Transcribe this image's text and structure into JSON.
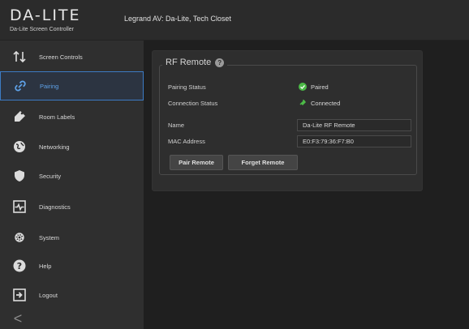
{
  "header": {
    "logo": "DA-LITE",
    "logo_sub": "Da-Lite Screen Controller",
    "device_title": "Legrand AV: Da-Lite, Tech Closet"
  },
  "sidebar": {
    "items": [
      {
        "label": "Screen Controls",
        "icon": "up-down-arrows-icon"
      },
      {
        "label": "Pairing",
        "icon": "link-icon",
        "active": true
      },
      {
        "label": "Room Labels",
        "icon": "tag-icon"
      },
      {
        "label": "Networking",
        "icon": "globe-icon"
      },
      {
        "label": "Security",
        "icon": "shield-icon"
      },
      {
        "label": "Diagnostics",
        "icon": "pulse-icon"
      },
      {
        "label": "System",
        "icon": "gear-icon"
      },
      {
        "label": "Help",
        "icon": "question-icon"
      },
      {
        "label": "Logout",
        "icon": "logout-icon"
      }
    ],
    "collapse_label": "<"
  },
  "panel": {
    "title": "RF Remote",
    "help": "?",
    "rows": [
      {
        "label": "Pairing Status",
        "value": "Paired"
      },
      {
        "label": "Connection Status",
        "value": "Connected"
      },
      {
        "label": "Name",
        "value": "Da-Lite RF Remote"
      },
      {
        "label": "MAC Address",
        "value": "E0:F3:79:36:F7:B0"
      }
    ],
    "buttons": {
      "pair": "Pair Remote",
      "forget": "Forget Remote"
    }
  },
  "colors": {
    "accent": "#3c7bc4",
    "active_text": "#5ea1e8",
    "status_green": "#4cba47"
  }
}
